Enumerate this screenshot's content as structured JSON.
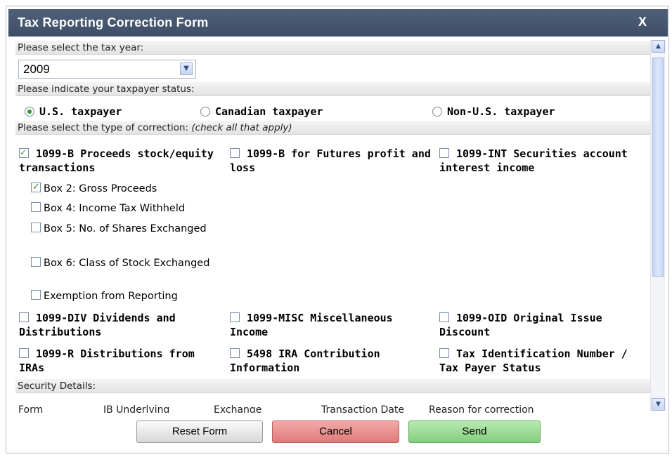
{
  "dialog": {
    "title": "Tax Reporting Correction Form",
    "close_label": "X"
  },
  "tax_year": {
    "prompt": "Please select the tax year:",
    "selected": "2009"
  },
  "taxpayer_status": {
    "prompt": "Please indicate your taxpayer status:",
    "options": [
      {
        "label": "U.S. taxpayer",
        "selected": true
      },
      {
        "label": "Canadian taxpayer",
        "selected": false
      },
      {
        "label": "Non-U.S. taxpayer",
        "selected": false
      }
    ]
  },
  "correction": {
    "prompt": "Please select the type of correction:",
    "prompt_note": "(check all that apply)",
    "types": [
      {
        "label": "1099-B Proceeds stock/equity transactions",
        "checked": true
      },
      {
        "label": "1099-B for Futures profit and loss",
        "checked": false
      },
      {
        "label": "1099-INT Securities account interest income",
        "checked": false
      },
      {
        "label": "1099-DIV Dividends and Distributions",
        "checked": false
      },
      {
        "label": "1099-MISC Miscellaneous Income",
        "checked": false
      },
      {
        "label": "1099-OID Original Issue Discount",
        "checked": false
      },
      {
        "label": "1099-R Distributions from IRAs",
        "checked": false
      },
      {
        "label": "5498 IRA Contribution Information",
        "checked": false
      },
      {
        "label": "Tax Identification Number / Tax Payer Status",
        "checked": false
      }
    ],
    "boxes": [
      {
        "label": "Box 2: Gross Proceeds",
        "checked": true
      },
      {
        "label": "Box 4: Income Tax Withheld",
        "checked": false
      },
      {
        "label": "Box 5: No. of Shares Exchanged",
        "checked": false
      },
      {
        "label": "Box 6: Class of Stock Exchanged",
        "checked": false
      },
      {
        "label": "Exemption from Reporting",
        "checked": false
      }
    ]
  },
  "security_details": {
    "title": "Security Details:",
    "columns": [
      "Form",
      "IB Underlying",
      "Exchange",
      "Transaction Date",
      "Reason for correction"
    ]
  },
  "buttons": {
    "reset": "Reset Form",
    "cancel": "Cancel",
    "send": "Send"
  },
  "colors": {
    "title_bar": "#45566f",
    "cancel": "#e98686",
    "send": "#8fd68a",
    "check": "#2b9a2b"
  }
}
